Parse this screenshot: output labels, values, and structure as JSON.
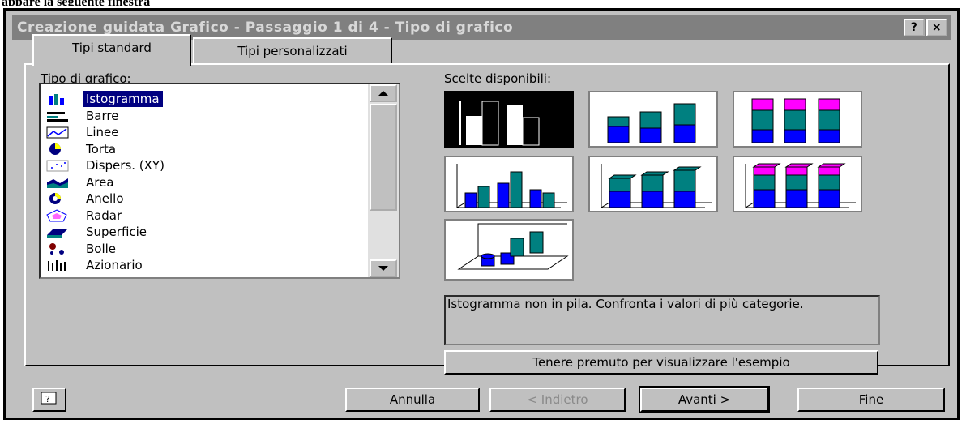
{
  "caption": "appare la seguente finestra",
  "window": {
    "title": "Creazione guidata Grafico - Passaggio 1 di 4 - Tipo di grafico",
    "help_button": "?",
    "close_button": "×"
  },
  "tabs": [
    {
      "label": "Tipi standard",
      "active": true
    },
    {
      "label": "Tipi personalizzati",
      "active": false
    }
  ],
  "chart_type_label": "Tipo di grafico:",
  "chart_types": [
    {
      "label": "Istogramma",
      "icon": "column-chart-icon",
      "selected": true
    },
    {
      "label": "Barre",
      "icon": "bar-chart-icon"
    },
    {
      "label": "Linee",
      "icon": "line-chart-icon"
    },
    {
      "label": "Torta",
      "icon": "pie-chart-icon"
    },
    {
      "label": "Dispers. (XY)",
      "icon": "scatter-chart-icon"
    },
    {
      "label": "Area",
      "icon": "area-chart-icon"
    },
    {
      "label": "Anello",
      "icon": "doughnut-chart-icon"
    },
    {
      "label": "Radar",
      "icon": "radar-chart-icon"
    },
    {
      "label": "Superficie",
      "icon": "surface-chart-icon"
    },
    {
      "label": "Bolle",
      "icon": "bubble-chart-icon"
    },
    {
      "label": "Azionario",
      "icon": "stock-chart-icon"
    }
  ],
  "subtypes_label": "Scelte disponibili:",
  "subtypes": [
    {
      "name": "clustered-column",
      "selected": true
    },
    {
      "name": "stacked-column"
    },
    {
      "name": "100-stacked-column"
    },
    {
      "name": "3d-clustered-column"
    },
    {
      "name": "3d-stacked-column"
    },
    {
      "name": "3d-100-stacked-column"
    },
    {
      "name": "3d-column"
    }
  ],
  "description": "Istogramma non in pila. Confronta i valori di più categorie.",
  "preview_button": "Tenere premuto per visualizzare l'esempio",
  "footer": {
    "cancel": "Annulla",
    "back": "< Indietro",
    "next": "Avanti >",
    "finish": "Fine"
  },
  "colors": {
    "blue": "#0000ff",
    "teal": "#008080",
    "magenta": "#ff00ff",
    "selection": "#000080",
    "dialog": "#c0c0c0"
  }
}
